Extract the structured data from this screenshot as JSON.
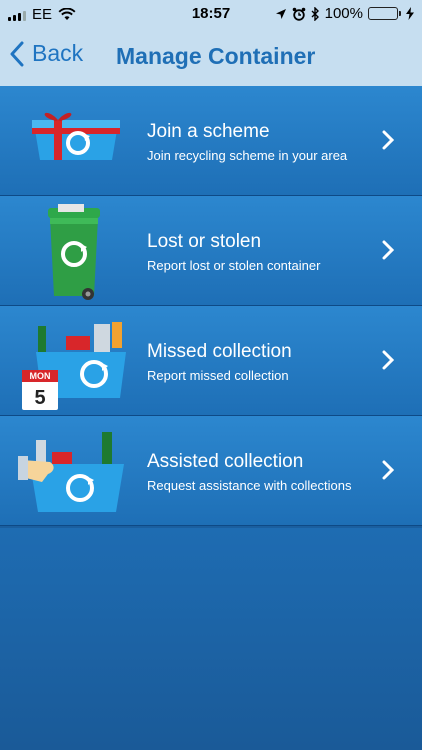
{
  "status": {
    "carrier": "EE",
    "time": "18:57",
    "battery": "100%",
    "icons": [
      "signal-icon",
      "wifi-icon",
      "location-icon",
      "alarm-icon",
      "bluetooth-icon",
      "battery-icon",
      "charging-icon"
    ]
  },
  "nav": {
    "back_label": "Back",
    "title": "Manage Container"
  },
  "items": [
    {
      "title": "Join a scheme",
      "subtitle": "Join recycling scheme in your area",
      "icon": "gift-box-icon"
    },
    {
      "title": "Lost or stolen",
      "subtitle": "Report lost or stolen container",
      "icon": "wheelie-bin-icon"
    },
    {
      "title": "Missed collection",
      "subtitle": "Report missed collection",
      "icon": "calendar-box-icon"
    },
    {
      "title": "Assisted collection",
      "subtitle": "Request assistance with collections",
      "icon": "helping-hand-box-icon"
    }
  ],
  "colors": {
    "accent": "#1f74c1",
    "row": "#2c87cf",
    "background": "#1a5fa0",
    "topbar": "#c6def0"
  }
}
